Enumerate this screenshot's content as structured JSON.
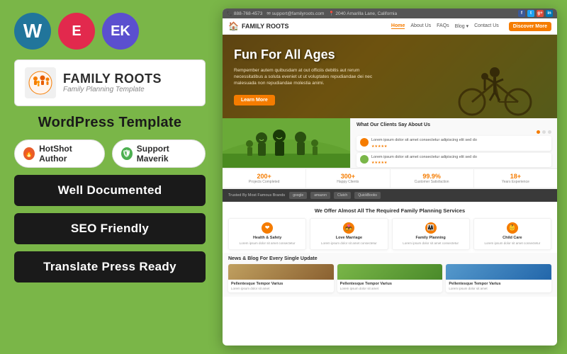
{
  "left": {
    "logos": [
      {
        "name": "wordpress",
        "symbol": "W",
        "bg": "#21759b"
      },
      {
        "name": "elementor",
        "symbol": "E",
        "bg": "#e2294d"
      },
      {
        "name": "extras",
        "symbol": "EK",
        "bg": "#5b4fcf"
      }
    ],
    "brand": {
      "title": "FAMILY ROOTS",
      "subtitle": "Family Planning Template"
    },
    "wp_template_label": "WordPress Template",
    "badges": [
      {
        "label": "HotShot Author",
        "icon": "🔥",
        "icon_bg": "#e85c2b"
      },
      {
        "label": "Support Maverik",
        "icon": "🛡",
        "icon_bg": "#4caf50"
      }
    ],
    "features": [
      "Well Documented",
      "SEO Friendly",
      "Translate Press Ready"
    ]
  },
  "preview": {
    "nav": {
      "top_bar": {
        "phone": "📞 888-768-4573",
        "email": "✉ support@familyroots.com",
        "address": "📍 2040 Amarilla Lane, California"
      },
      "brand_name": "FAMILY ROOTS",
      "links": [
        "Home",
        "About Us",
        "FAQs",
        "Blog",
        "Contact Us"
      ],
      "cta": "Discover More"
    },
    "hero": {
      "title": "Fun For All Ages",
      "text": "Rempember autem quibusdam at out officiis debitis aut rerum necessitatibus a soluta eveniet ut ut voluptates repudiandae dei nec malesuada non repudiandae molestia animi.",
      "btn": "Learn More"
    },
    "testimonials_title": "What Our Clients Say About Us",
    "stats": [
      {
        "number": "200+",
        "label": "Projects Completed"
      },
      {
        "number": "300+",
        "label": "Happy Clients"
      },
      {
        "number": "99.9%",
        "label": "Customer Satisfaction"
      },
      {
        "number": "18+",
        "label": "Years Experience"
      }
    ],
    "trusted": {
      "label": "Trusted By Most Famous Brands",
      "logos": [
        "google",
        "amazon",
        "Clutch",
        "QuickBooks"
      ]
    },
    "services": {
      "title": "We Offer Almost All The Required Family Planning Services",
      "items": [
        {
          "name": "Health & Safety",
          "desc": "Lorem ipsum dolor sit amet consectetur"
        },
        {
          "name": "Love Marriage",
          "desc": "Lorem ipsum dolor sit amet consectetur"
        },
        {
          "name": "Family Planning",
          "desc": "Lorem ipsum dolor sit amet consectetur"
        },
        {
          "name": "Child Care",
          "desc": "Lorem ipsum dolor sit amet consectetur"
        }
      ]
    },
    "blog": {
      "title": "News & Blog For Every Single Update",
      "posts": [
        {
          "title": "Pellentesque Tempor Varius",
          "desc": "Lorem ipsum dolor sit amet"
        },
        {
          "title": "Pellentesque Tempor Varius",
          "desc": "Lorem ipsum dolor sit amet"
        },
        {
          "title": "Pellentesque Tempor Varius",
          "desc": "Lorem ipsum dolor sit amet"
        }
      ]
    }
  }
}
